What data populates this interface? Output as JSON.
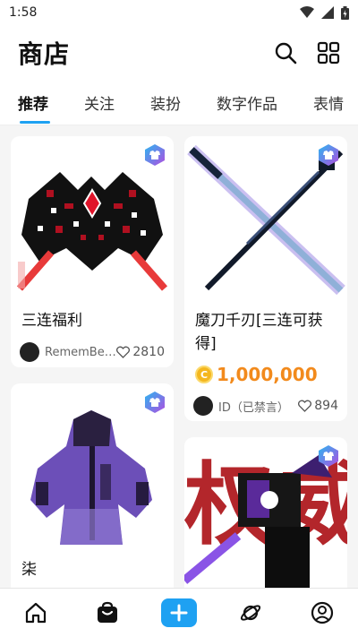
{
  "status": {
    "time": "1:58"
  },
  "header": {
    "title": "商店",
    "search_icon": "search-icon",
    "grid_icon": "grid-icon"
  },
  "tabs": [
    {
      "label": "推荐",
      "active": true
    },
    {
      "label": "关注"
    },
    {
      "label": "装扮"
    },
    {
      "label": "数字作品"
    },
    {
      "label": "表情"
    }
  ],
  "items": [
    {
      "title": "三连福利",
      "author": "RememBer...",
      "likes": "2810",
      "type_icon": "shirt-icon"
    },
    {
      "title": "魔刀千刃[三连可获得]",
      "price": "1,000,000",
      "author": "ID（已禁言）",
      "likes": "894",
      "type_icon": "shirt-icon"
    },
    {
      "title": "柒",
      "type_icon": "shirt-icon"
    },
    {
      "image_text": "权威",
      "type_icon": "shirt-icon"
    }
  ],
  "bottom_nav": [
    {
      "name": "home-icon"
    },
    {
      "name": "shop-bag-icon"
    },
    {
      "name": "add-icon"
    },
    {
      "name": "planet-icon"
    },
    {
      "name": "profile-icon"
    }
  ],
  "colors": {
    "accent": "#1ea1f2",
    "price": "#f28a1c",
    "coin": "#f4b71f"
  }
}
